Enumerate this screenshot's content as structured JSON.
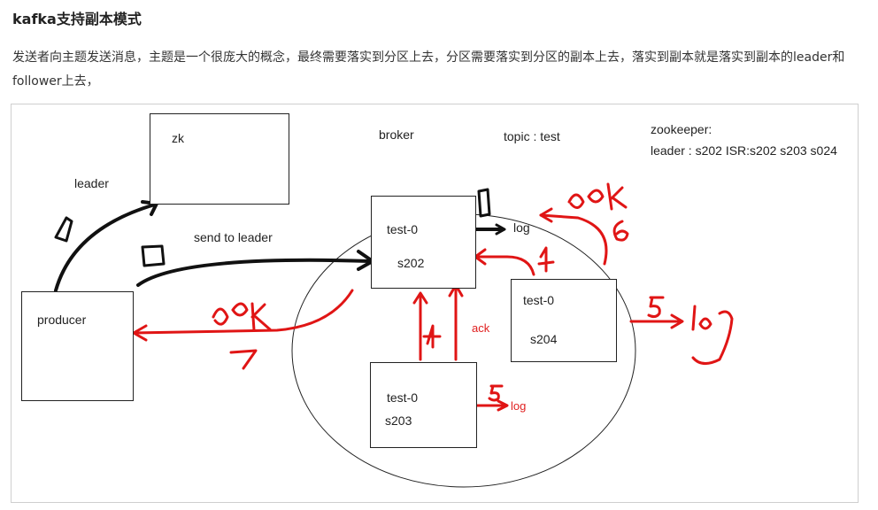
{
  "title": "kafka支持副本模式",
  "paragraph": "发送者向主题发送消息，主题是一个很庞大的概念，最终需要落实到分区上去，分区需要落实到分区的副本上去，落实到副本就是落实到副本的leader和follower上去，",
  "diagram": {
    "zk": "zk",
    "leader": "leader",
    "producer": "producer",
    "send_to_leader": "send to leader",
    "broker": "broker",
    "topic": "topic : test",
    "zookeeper_line1": "zookeeper:",
    "zookeeper_line2": "leader : s202  ISR:s202 s203 s024",
    "leader_partition": "test-0",
    "leader_server": "s202",
    "follower1_partition": "test-0",
    "follower1_server": "s204",
    "follower2_partition": "test-0",
    "follower2_server": "s203",
    "log_leader": "log",
    "ack_red": "ack",
    "log_s203": "log",
    "annotations": [
      "1",
      "2",
      "3",
      "4",
      "5",
      "6",
      "7",
      "ack",
      "log"
    ],
    "colors": {
      "ink": "#111111",
      "annotation": "#e01515"
    }
  }
}
